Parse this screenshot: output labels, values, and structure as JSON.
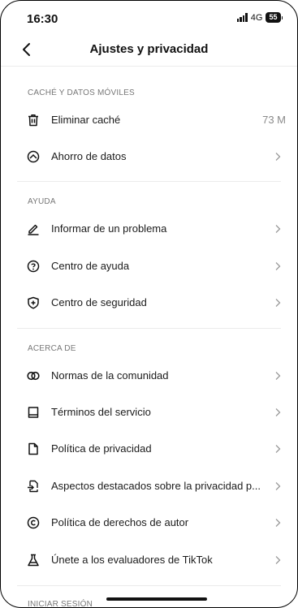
{
  "status_bar": {
    "time": "16:30",
    "network": "4G",
    "battery": "55"
  },
  "nav": {
    "title": "Ajustes y privacidad"
  },
  "sections": [
    {
      "title": "CACHÉ Y DATOS MÓVILES",
      "items": [
        {
          "label": "Eliminar caché",
          "value": "73 M",
          "icon": "trash-icon"
        },
        {
          "label": "Ahorro de datos",
          "icon": "data-saver-icon"
        }
      ]
    },
    {
      "title": "AYUDA",
      "items": [
        {
          "label": "Informar de un problema",
          "icon": "pencil-icon"
        },
        {
          "label": "Centro de ayuda",
          "icon": "question-circle-icon"
        },
        {
          "label": "Centro de seguridad",
          "icon": "shield-plus-icon"
        }
      ]
    },
    {
      "title": "ACERCA DE",
      "items": [
        {
          "label": "Normas de la comunidad",
          "icon": "linked-circles-icon"
        },
        {
          "label": "Términos del servicio",
          "icon": "book-icon"
        },
        {
          "label": "Política de privacidad",
          "icon": "document-icon"
        },
        {
          "label": "Aspectos destacados sobre la privacidad p...",
          "icon": "privacy-highlights-icon"
        },
        {
          "label": "Política de derechos de autor",
          "icon": "copyright-icon"
        },
        {
          "label": "Únete a los evaluadores de TikTok",
          "icon": "flask-icon"
        }
      ]
    },
    {
      "title": "INICIAR SESIÓN",
      "items": []
    }
  ]
}
